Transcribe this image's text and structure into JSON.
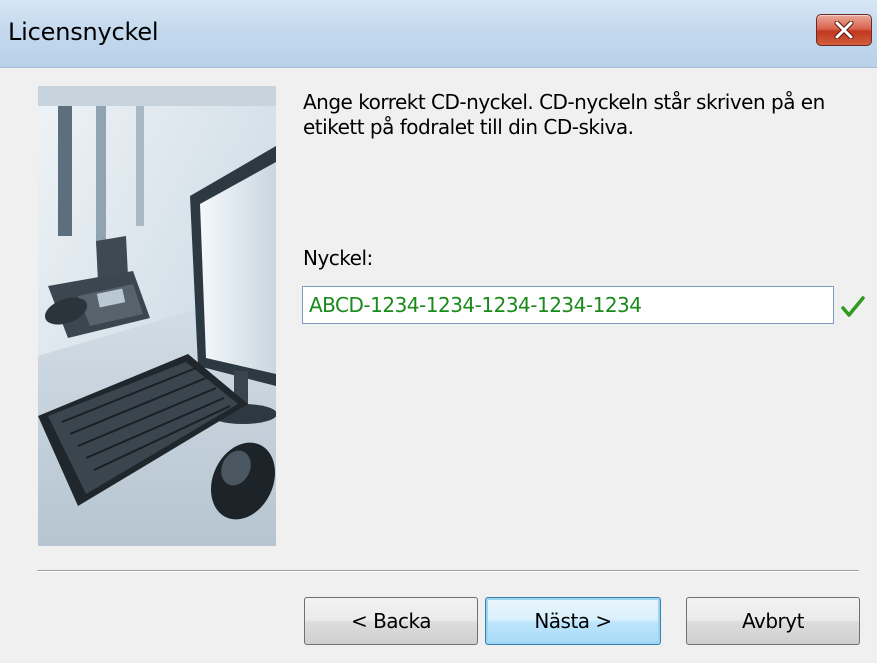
{
  "window": {
    "title": "Licensnyckel"
  },
  "title_bar": {
    "close_icon": "close-x-icon"
  },
  "content": {
    "instruction": "Ange korrekt CD-nyckel. CD-nyckeln står skriven på en etikett på fodralet till din CD-skiva.",
    "key_label": "Nyckel:",
    "key_value": "ABCD-1234-1234-1234-1234-1234",
    "key_status_icon": "checkmark-icon",
    "key_status_color": "#2e9a1e",
    "key_text_color": "#1a8a1a"
  },
  "picture": {
    "subject": "office desk with computer monitor, telephone, keyboard and mouse"
  },
  "buttons": {
    "back_label": "< Backa",
    "next_label": "Nästa >",
    "cancel_label": "Avbryt"
  }
}
